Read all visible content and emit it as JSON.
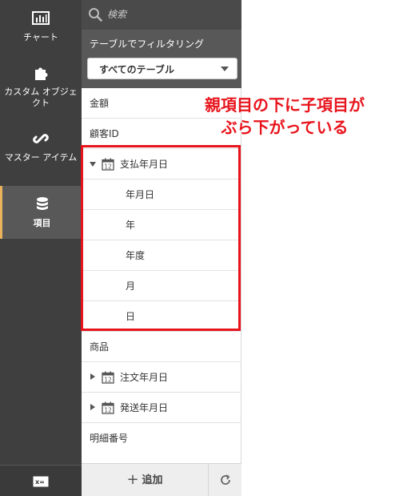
{
  "rail": {
    "items": [
      {
        "label": "チャート",
        "icon": "bar-chart-icon"
      },
      {
        "label": "カスタム オブジェクト",
        "icon": "puzzle-icon"
      },
      {
        "label": "マスター アイテム",
        "icon": "link-icon"
      },
      {
        "label": "項目",
        "icon": "database-icon",
        "active": true
      }
    ],
    "bottom_icon": "variables-icon"
  },
  "panel": {
    "search_placeholder": "検索",
    "filter_label": "テーブルでフィルタリング",
    "table_select_value": "すべてのテーブル",
    "fields": [
      {
        "label": "金額"
      },
      {
        "label": "顧客ID"
      },
      {
        "label": "支払年月日",
        "expanded": true,
        "children": [
          "年月日",
          "年",
          "年度",
          "月",
          "日"
        ]
      },
      {
        "label": "商品"
      },
      {
        "label": "注文年月日",
        "expanded": false
      },
      {
        "label": "発送年月日",
        "expanded": false
      },
      {
        "label": "明細番号"
      }
    ],
    "add_label": "追加"
  },
  "annotation": {
    "line1": "親項目の下に子項目が",
    "line2": "ぶら下がっている",
    "color": "#e8141c"
  },
  "colors": {
    "rail_bg": "#3f3f3f",
    "active_accent": "#e9b35b",
    "panel_head_bg": "#585858"
  }
}
